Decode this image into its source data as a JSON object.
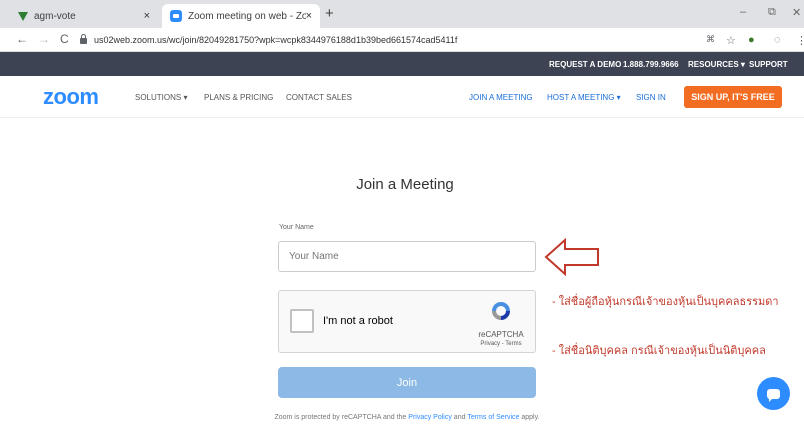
{
  "browser": {
    "tabs": [
      {
        "title": "agm-vote",
        "close": "×"
      },
      {
        "title": "Zoom meeting on web - Zoom",
        "close": "×"
      }
    ],
    "new_tab": "+",
    "window_controls": {
      "minimize": "–",
      "maximize": "⧉",
      "close": "✕"
    },
    "nav": {
      "back": "←",
      "forward": "→",
      "reload": "C"
    },
    "url": "us02web.zoom.us/wc/join/82049281750?wpk=wcpk8344976188d1b39bed661574cad5411f",
    "icons": [
      "translate-icon",
      "star-icon",
      "extension-icon",
      "profile-icon",
      "menu-icon"
    ]
  },
  "topbar": {
    "request_demo": "REQUEST A DEMO",
    "phone": "1.888.799.9666",
    "resources": "RESOURCES ▾",
    "support": "SUPPORT"
  },
  "nav": {
    "logo": "zoom",
    "solutions": "SOLUTIONS ▾",
    "plans": "PLANS & PRICING",
    "contact": "CONTACT SALES",
    "join": "JOIN A MEETING",
    "host": "HOST A MEETING ▾",
    "signin": "SIGN IN",
    "signup": "SIGN UP, IT'S FREE"
  },
  "form": {
    "title": "Join a Meeting",
    "name_label": "Your Name",
    "name_placeholder": "Your Name",
    "captcha_text": "I'm not a robot",
    "captcha_brand": "reCAPTCHA",
    "captcha_links": "Privacy - Terms",
    "join_button": "Join",
    "footer_prefix": "Zoom is protected by reCAPTCHA and the ",
    "footer_privacy": "Privacy Policy",
    "footer_and": " and ",
    "footer_terms": "Terms of Service",
    "footer_suffix": " apply."
  },
  "annotations": {
    "note1": "- ใส่ชื่อผู้ถือหุ้นกรณีเจ้าของหุ้นเป็นบุคคลธรรมดา",
    "note2": "- ใส่ชื่อนิติบุคคล กรณีเจ้าของหุ้นเป็นนิติบุคคล",
    "arrow_color": "#c0392b"
  },
  "colors": {
    "zoom_blue": "#2d8cff",
    "signup_orange": "#f26d21",
    "topbar": "#3d4353",
    "join_button": "#8cb9e6"
  }
}
